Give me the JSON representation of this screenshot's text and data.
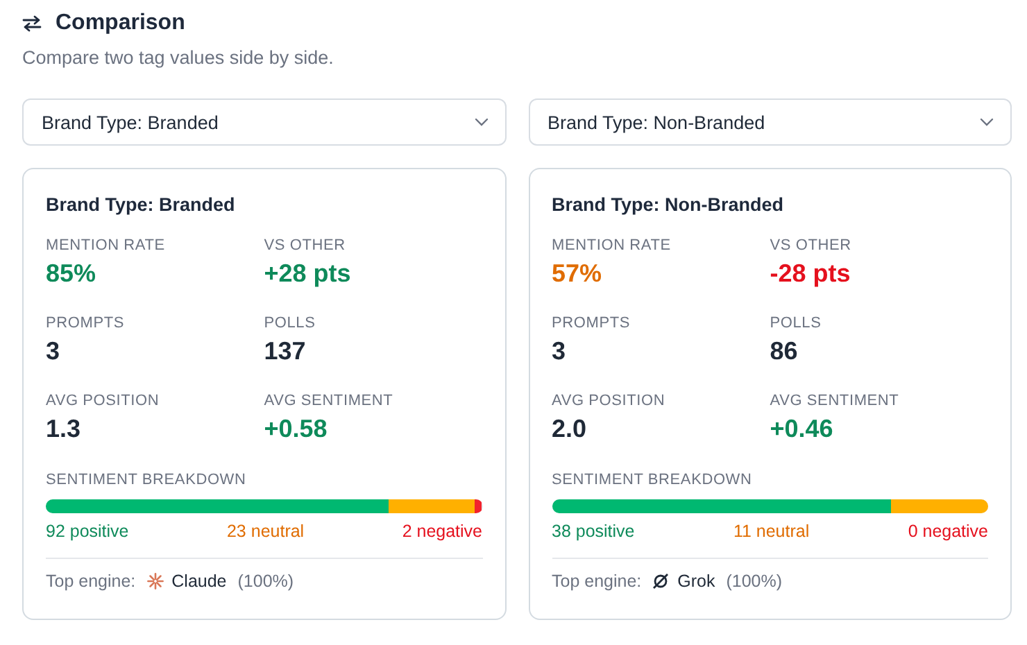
{
  "header": {
    "title": "Comparison",
    "subtitle": "Compare two tag values side by side."
  },
  "selects": [
    {
      "value": "Brand Type: Branded"
    },
    {
      "value": "Brand Type: Non-Branded"
    }
  ],
  "cards": [
    {
      "title": "Brand Type: Branded",
      "stats": [
        {
          "label": "MENTION RATE",
          "value": "85%",
          "color": "#0e8a5a"
        },
        {
          "label": "VS OTHER",
          "value": "+28 pts",
          "color": "#0e8a5a"
        },
        {
          "label": "PROMPTS",
          "value": "3",
          "color": "#1f2937"
        },
        {
          "label": "POLLS",
          "value": "137",
          "color": "#1f2937"
        },
        {
          "label": "AVG POSITION",
          "value": "1.3",
          "color": "#1f2937"
        },
        {
          "label": "AVG SENTIMENT",
          "value": "+0.58",
          "color": "#0e8a5a"
        }
      ],
      "breakdown": {
        "label": "SENTIMENT BREAKDOWN",
        "bar": [
          {
            "level": 0.786,
            "color": "#00b871"
          },
          {
            "level": 0.197,
            "color": "#ffb000"
          },
          {
            "level": 0.017,
            "color": "#f2222d"
          }
        ],
        "counts": [
          {
            "text": "92 positive",
            "color": "#0e8a5a"
          },
          {
            "text": "23 neutral",
            "color": "#e06c00"
          },
          {
            "text": "2 negative",
            "color": "#e5101d"
          }
        ]
      },
      "engine": {
        "label": "Top engine:",
        "kind": "starburst",
        "name": "Claude",
        "share": "(100%)"
      }
    },
    {
      "title": "Brand Type: Non-Branded",
      "stats": [
        {
          "label": "MENTION RATE",
          "value": "57%",
          "color": "#e06c00"
        },
        {
          "label": "VS OTHER",
          "value": "-28 pts",
          "color": "#e5101d"
        },
        {
          "label": "PROMPTS",
          "value": "3",
          "color": "#1f2937"
        },
        {
          "label": "POLLS",
          "value": "86",
          "color": "#1f2937"
        },
        {
          "label": "AVG POSITION",
          "value": "2.0",
          "color": "#1f2937"
        },
        {
          "label": "AVG SENTIMENT",
          "value": "+0.46",
          "color": "#0e8a5a"
        }
      ],
      "breakdown": {
        "label": "SENTIMENT BREAKDOWN",
        "bar": [
          {
            "level": 0.776,
            "color": "#00b871"
          },
          {
            "level": 0.224,
            "color": "#ffb000"
          }
        ],
        "counts": [
          {
            "text": "38 positive",
            "color": "#0e8a5a"
          },
          {
            "text": "11 neutral",
            "color": "#e06c00"
          },
          {
            "text": "0 negative",
            "color": "#e5101d"
          }
        ]
      },
      "engine": {
        "label": "Top engine:",
        "kind": "slashed-circle",
        "name": "Grok",
        "share": "(100%)"
      }
    }
  ]
}
